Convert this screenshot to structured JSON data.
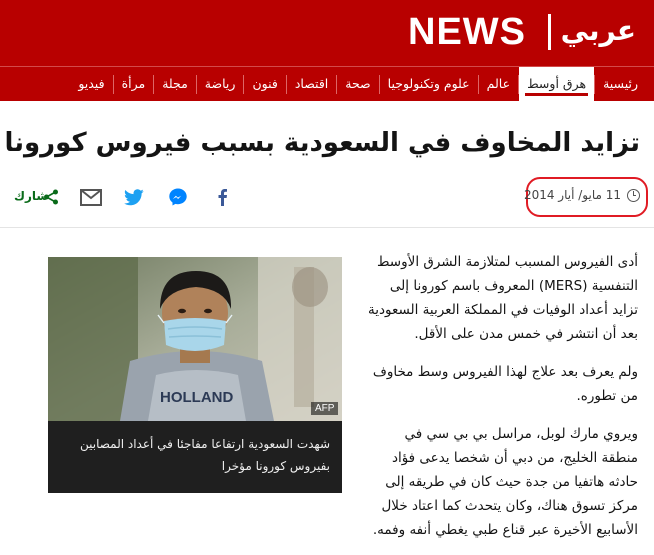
{
  "header": {
    "brand_latin": "NEWS",
    "brand_arabic": "عربي",
    "brand_color": "#b80000"
  },
  "nav": {
    "items": [
      {
        "label": "رئيسية",
        "active": false
      },
      {
        "label": "هرق أوسط",
        "active": true
      },
      {
        "label": "عالم",
        "active": false
      },
      {
        "label": "علوم وتكنولوجيا",
        "active": false
      },
      {
        "label": "صحة",
        "active": false
      },
      {
        "label": "اقتصاد",
        "active": false
      },
      {
        "label": "فنون",
        "active": false
      },
      {
        "label": "رياضة",
        "active": false
      },
      {
        "label": "مجلة",
        "active": false
      },
      {
        "label": "مرأة",
        "active": false
      },
      {
        "label": "فيديو",
        "active": false
      }
    ]
  },
  "article": {
    "headline": "تزايد المخاوف في السعودية بسبب فيروس كورونا",
    "date": "11 مايو/ أيار 2014",
    "share_label": "شارك",
    "share_icons": [
      "share-icon",
      "email-icon",
      "twitter-icon",
      "messenger-icon",
      "facebook-icon"
    ],
    "figure": {
      "credit": "AFP",
      "caption": "شهدت السعودية ارتفاعا مفاجئا في أعداد المصابين بفيروس كورونا مؤخرا",
      "shirt_text": "HOLLAND"
    },
    "paragraphs": [
      "أدى الفيروس المسبب لمتلازمة الشرق الأوسط التنفسية (MERS) المعروف باسم كورونا إلى تزايد أعداد الوفيات في المملكة العربية السعودية بعد أن انتشر في خمس مدن على الأقل.",
      "ولم يعرف بعد علاج لهذا الفيروس وسط مخاوف من تطوره.",
      "ويروي مارك لوبل، مراسل بي بي سي في منطقة الخليج، من دبي أن شخصا يدعى فؤاد حادثه هاتفيا من جدة حيث كان في طريقه إلى مركز تسوق هناك، وكان يتحدث كما اعتاد خلال الأسابيع الأخيرة عبر قناع طبي يغطي أنفه وفمه."
    ]
  },
  "colors": {
    "annotation_circle": "#e01b24",
    "share_label": "#0a6b1a",
    "facebook": "#3b5998",
    "messenger": "#0084ff",
    "twitter": "#1da1f2"
  }
}
